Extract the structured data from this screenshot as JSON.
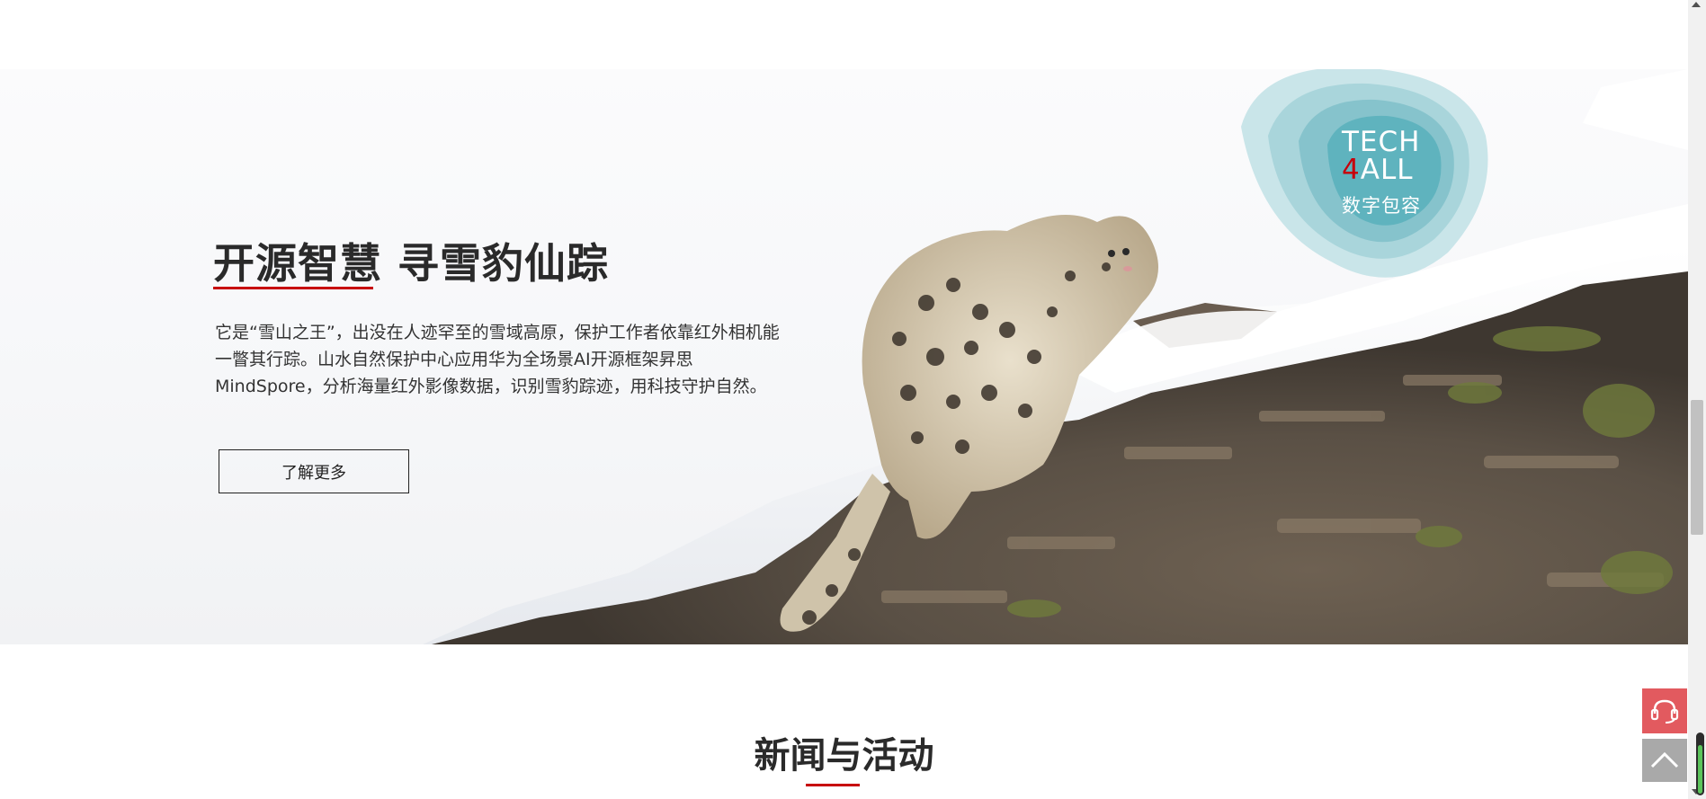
{
  "banner": {
    "title": "开源智慧 寻雪豹仙踪",
    "description": "它是“雪山之王”，出没在人迹罕至的雪域高原，保护工作者依靠红外相机能一瞥其行踪。山水自然保护中心应用华为全场景AI开源框架昇思MindSpore，分析海量红外影像数据，识别雪豹踪迹，用科技守护自然。",
    "learn_more_label": "了解更多",
    "image": "snow-leopard-on-rock-photo"
  },
  "tech4all_logo": {
    "line1": "TECH",
    "four": "4",
    "all": "ALL",
    "subtitle": "数字包容"
  },
  "news_section": {
    "title": "新闻与活动"
  },
  "floating_tools": {
    "support_icon": "headset-icon",
    "top_icon": "chevron-up-icon"
  },
  "colors": {
    "accent": "#c7000b",
    "logo_teal": "#5fb3be",
    "support_red": "#e25a5f",
    "back_to_top_gray": "#a9a9a9"
  }
}
